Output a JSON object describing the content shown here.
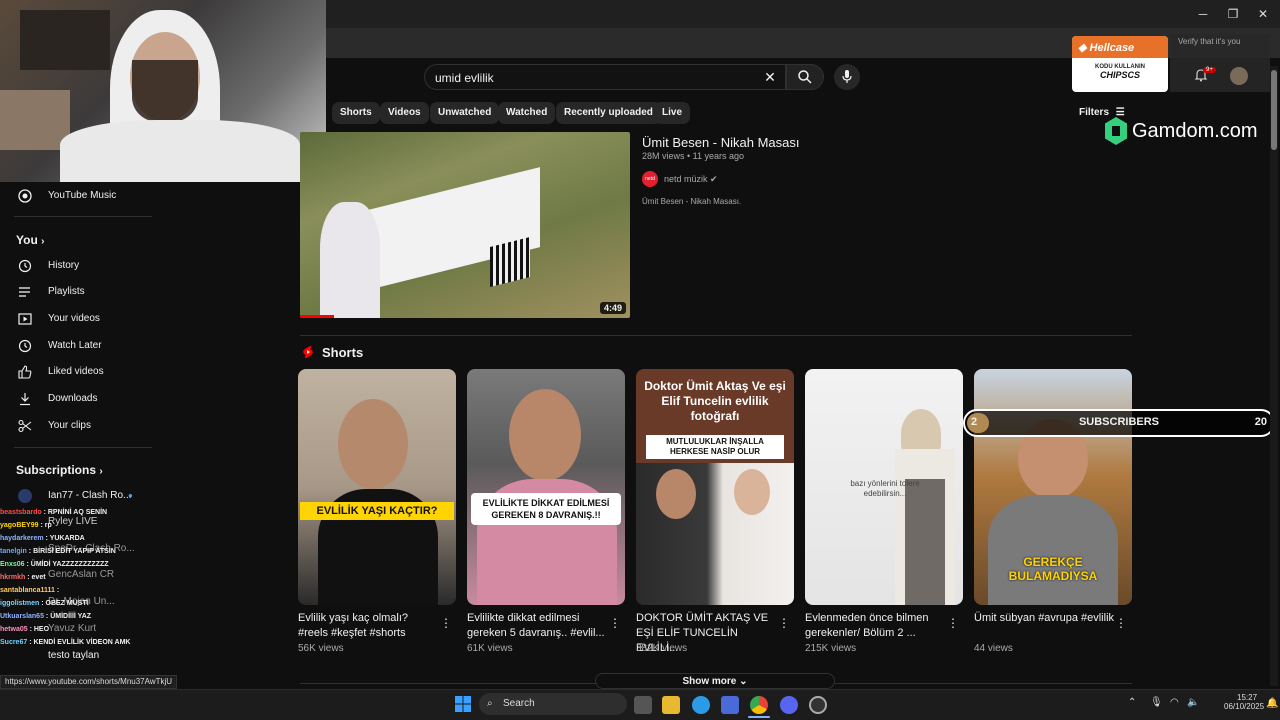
{
  "search": {
    "query": "umid evlilik"
  },
  "chips": [
    "Shorts",
    "Videos",
    "Unwatched",
    "Watched",
    "Recently uploaded",
    "Live"
  ],
  "filters_label": "Filters",
  "sidebar": {
    "music": "YouTube Music",
    "you_header": "You",
    "you_items": [
      "History",
      "Playlists",
      "Your videos",
      "Watch Later",
      "Liked videos",
      "Downloads",
      "Your clips"
    ],
    "subs_header": "Subscriptions",
    "subs_items": [
      "Ian77 - Clash Ro...",
      "Ryley LIVE",
      "SpeDr - Clash Ro...",
      "GencAslan CR",
      "Dr. Mojan Un...",
      "Yavuz Kurt",
      "testo taylan"
    ]
  },
  "video": {
    "title": "Ümit Besen - Nikah Masası",
    "meta": "28M views • 11 years ago",
    "channel": "netd müzik",
    "channel_avatar_text": "netd",
    "description": "Ümit Besen - Nikah Masası.",
    "duration": "4:49"
  },
  "shorts_header": "Shorts",
  "shorts": [
    {
      "overlay": "EVLİLİK YAŞI KAÇTIR?",
      "title": "Evlilik yaşı kaç olmalı? #reels #keşfet #shorts",
      "views": "56K views"
    },
    {
      "overlay": "EVLİLİKTE DİKKAT EDİLMESİ GEREKEN 8 DAVRANIŞ.!!",
      "title": "Evlilikte dikkat edilmesi gereken 5 davranış.. #evlil...",
      "views": "61K views"
    },
    {
      "overlay": "Doktor Ümit Aktaş Ve eşi Elif Tuncelin evlilik fotoğrafı",
      "overlay2": "MUTLULUKLAR İNŞALLA HERKESE NASİP OLUR",
      "title": "DOKTOR ÜMİT AKTAŞ VE EŞİ ELİF TUNCELİN EVLİLİ...",
      "views": "382K views"
    },
    {
      "overlay": "bazı yönlerini tolere edebilirsin...",
      "title": "Evlenmeden önce bilmen gerekenler/ Bölüm 2 ...",
      "views": "215K views"
    },
    {
      "overlay": "GEREKÇE BULAMADIYSA",
      "title": "Ümit sübyan #avrupa #evlilik",
      "views": "44 views"
    }
  ],
  "show_more": "Show more",
  "overlays": {
    "hellcase": "Hellcase",
    "hellcase_code_label": "KODU KULLANIN",
    "hellcase_code": "CHIPSCS",
    "verify": "Verify that it's you",
    "gamdom": "Gamdom.com",
    "subscribers_count_left": "2",
    "subscribers_label": "SUBSCRIBERS",
    "subscribers_count_right": "20",
    "notif_badge": "9+"
  },
  "chat": [
    {
      "user": "beastsbardo",
      "msg": "RPNİNİ AQ SENİN",
      "color": "#ff4d4d"
    },
    {
      "user": "yagoBEY99",
      "msg": "rp",
      "color": "#ffd700"
    },
    {
      "user": "haydarkerem",
      "msg": "YUKARDA",
      "color": "#8fb3ff"
    },
    {
      "user": "tanelgin",
      "msg": "BİRİSİ EDİT YAPIP ATSIN",
      "color": "#6fa8ff"
    },
    {
      "user": "Enxs06",
      "msg": "ÜMİDİ YAZZZZZZZZZZZ",
      "color": "#6fff9a"
    },
    {
      "user": "hkrmkh",
      "msg": "evet",
      "color": "#ff6b6b"
    },
    {
      "user": "santablanca1111",
      "msg": "",
      "color": "#ffcc66"
    },
    {
      "user": "iggolistmen",
      "msg": "OBEZ MUSTİ",
      "color": "#7fd4ff"
    },
    {
      "user": "Utkuarslan65",
      "msg": "ÜMİDİİİİ YAZ",
      "color": "#8fb3ff"
    },
    {
      "user": "hetwa05",
      "msg": "HEO",
      "color": "#ff8fbf"
    },
    {
      "user": "Sucre67",
      "msg": "KENDİ EVLİLİK VİDEON AMK",
      "color": "#6fd3ff"
    }
  ],
  "status_url": "https://www.youtube.com/shorts/Mnu37AwTkjU",
  "taskbar": {
    "search": "Search",
    "time": "15:27",
    "date": "06/10/2025"
  },
  "colors": {
    "accent": "#ff0000",
    "chip_bg": "#272727",
    "gamdom": "#35d07f",
    "hellcase": "#e8712a"
  }
}
